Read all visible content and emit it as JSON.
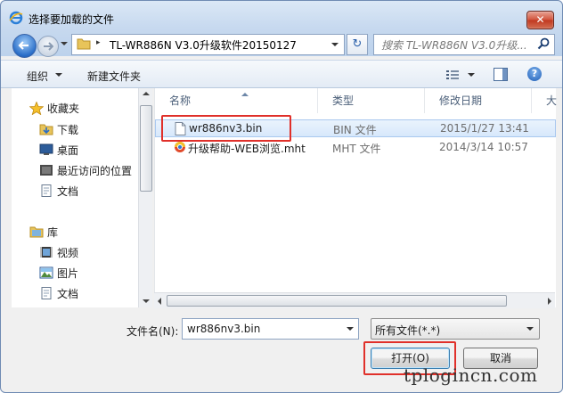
{
  "window": {
    "title": "选择要加载的文件",
    "close_label": "✕"
  },
  "address": {
    "arrow": "▸",
    "path": "TL-WR886N V3.0升级软件20150127",
    "refresh_label": "↻"
  },
  "search": {
    "placeholder": "搜索 TL-WR886N V3.0升级..."
  },
  "toolbar": {
    "organize_label": "组织",
    "new_folder_label": "新建文件夹",
    "help_label": "?"
  },
  "sidebar": {
    "favorites": {
      "label": "收藏夹",
      "items": [
        {
          "label": "下载"
        },
        {
          "label": "桌面"
        },
        {
          "label": "最近访问的位置"
        },
        {
          "label": "文档"
        }
      ]
    },
    "libraries": {
      "label": "库",
      "items": [
        {
          "label": "视频"
        },
        {
          "label": "图片"
        },
        {
          "label": "文档"
        }
      ]
    }
  },
  "columns": {
    "name": "名称",
    "type": "类型",
    "modified": "修改日期",
    "size": "大"
  },
  "files": [
    {
      "name": "wr886nv3.bin",
      "type": "BIN 文件",
      "modified": "2015/1/27 13:41",
      "selected": true
    },
    {
      "name": "升级帮助-WEB浏览.mht",
      "type": "MHT 文件",
      "modified": "2014/3/14 10:57",
      "selected": false
    }
  ],
  "filename": {
    "label": "文件名(N):",
    "value": "wr886nv3.bin"
  },
  "filetype": {
    "selected": "所有文件(*.*)"
  },
  "buttons": {
    "open_label": "打开(O)",
    "cancel_label": "取消"
  },
  "watermark": "tplogincn.com",
  "colors": {
    "highlight_box": "#e0302a",
    "selection": "#d7e8fb",
    "close_button": "#c0381f"
  }
}
